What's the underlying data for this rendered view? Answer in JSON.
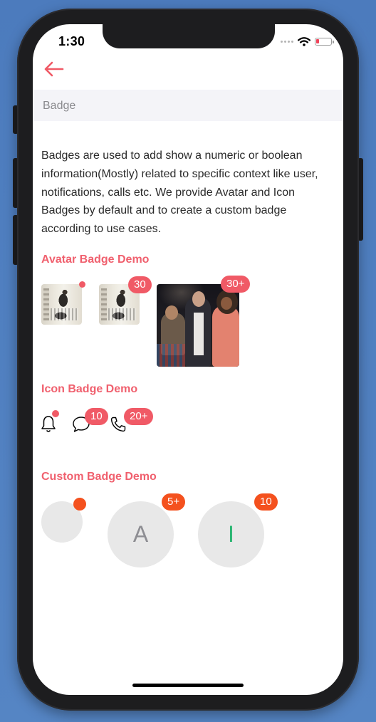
{
  "status_bar": {
    "time": "1:30"
  },
  "header": {
    "section_title": "Badge"
  },
  "description": "Badges are used to add show a numeric or boolean information(Mostly) related to specific context like user, notifications, calls etc. We provide Avatar and Icon Badges by default and to create a custom badge according to use cases.",
  "avatar_demo": {
    "title": "Avatar Badge Demo",
    "avatars": [
      {
        "badge": ""
      },
      {
        "badge": "30"
      },
      {
        "badge": "30+"
      }
    ]
  },
  "icon_demo": {
    "title": "Icon Badge Demo",
    "icons": [
      {
        "icon": "bell-icon",
        "badge": ""
      },
      {
        "icon": "chat-icon",
        "badge": "10"
      },
      {
        "icon": "phone-icon",
        "badge": "20+"
      }
    ]
  },
  "custom_demo": {
    "title": "Custom Badge Demo",
    "items": [
      {
        "letter": "",
        "badge": ""
      },
      {
        "letter": "A",
        "badge": "5+"
      },
      {
        "letter": "I",
        "badge": "10"
      }
    ]
  },
  "colors": {
    "accent": "#f05a66",
    "custom_badge": "#f4511e",
    "letter_a": "#8e8e93",
    "letter_i": "#2bb673"
  }
}
